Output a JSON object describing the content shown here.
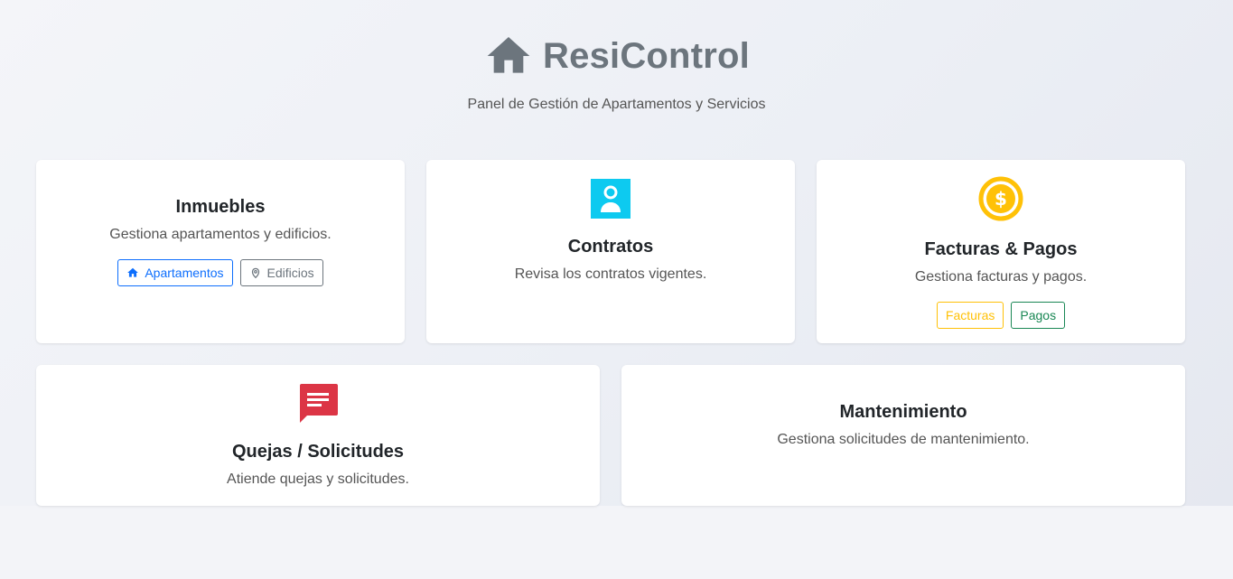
{
  "header": {
    "title": "ResiControl",
    "subtitle": "Panel de Gestión de Apartamentos y Servicios",
    "icon": "home-icon"
  },
  "colors": {
    "blue": "#0d6efd",
    "gray": "#6c757d",
    "cyan": "#0dcaf0",
    "yellow": "#ffc107",
    "green": "#198754",
    "red": "#dc3545"
  },
  "cards": {
    "inmuebles": {
      "title": "Inmuebles",
      "description": "Gestiona apartamentos y edificios.",
      "buttons": [
        {
          "label": "Apartamentos",
          "icon": "home-icon"
        },
        {
          "label": "Edificios",
          "icon": "map-pin-icon"
        }
      ]
    },
    "contratos": {
      "title": "Contratos",
      "description": "Revisa los contratos vigentes.",
      "icon": "person-badge-icon"
    },
    "facturas": {
      "title": "Facturas & Pagos",
      "description": "Gestiona facturas y pagos.",
      "icon": "dollar-coin-icon",
      "buttons": [
        {
          "label": "Facturas"
        },
        {
          "label": "Pagos"
        }
      ]
    },
    "quejas": {
      "title": "Quejas / Solicitudes",
      "description": "Atiende quejas y solicitudes.",
      "icon": "chat-message-icon"
    },
    "mantenimiento": {
      "title": "Mantenimiento",
      "description": "Gestiona solicitudes de mantenimiento."
    }
  }
}
